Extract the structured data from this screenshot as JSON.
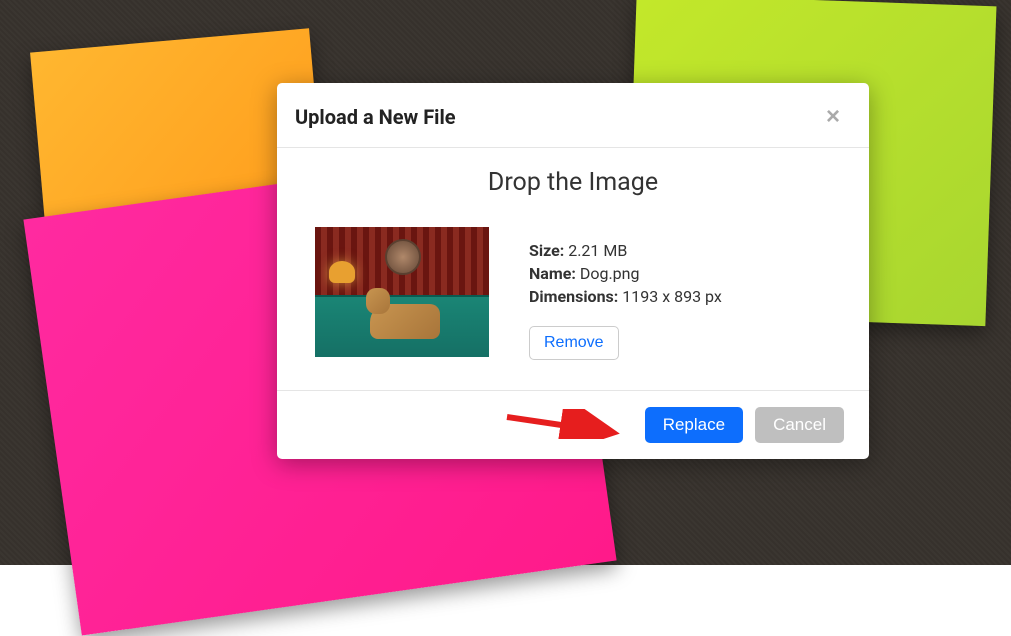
{
  "modal": {
    "title": "Upload a New File",
    "drop_title": "Drop the Image",
    "details": {
      "size_label": "Size:",
      "size_value": "2.21 MB",
      "name_label": "Name:",
      "name_value": "Dog.png",
      "dimensions_label": "Dimensions:",
      "dimensions_value": "1193 x 893 px"
    },
    "remove_label": "Remove",
    "replace_label": "Replace",
    "cancel_label": "Cancel"
  }
}
